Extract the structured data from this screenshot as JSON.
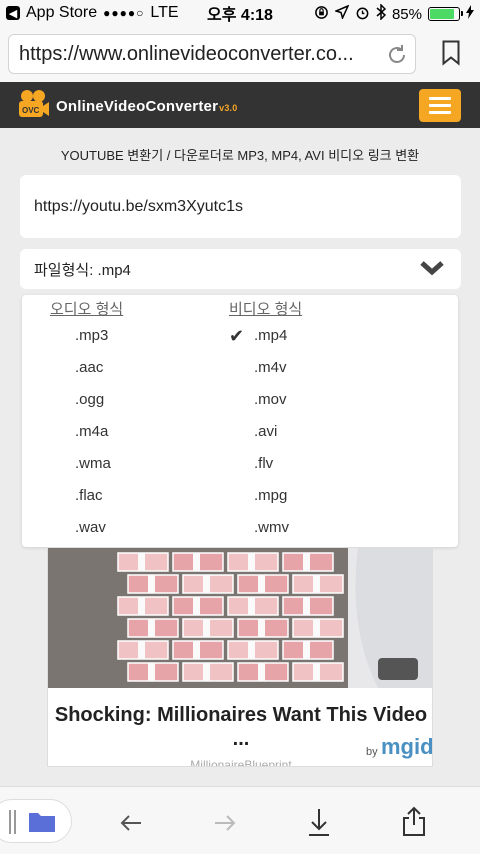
{
  "status_bar": {
    "back_app": "App Store",
    "carrier": "LTE",
    "time": "오후 4:18",
    "battery": "85%"
  },
  "browser": {
    "url": "https://www.onlinevideoconverter.co..."
  },
  "site": {
    "logo_badge": "OVC",
    "logo_name_1": "Online",
    "logo_name_2": "Video",
    "logo_name_3": "Converter",
    "logo_version": "v3.0",
    "tagline": "YOUTUBE 변환기 / 다운로더로 MP3, MP4, AVI 비디오 링크 변환",
    "url_input_value": "https://youtu.be/sxm3Xyutc1s",
    "format_label": "파일형식: .mp4"
  },
  "dropdown": {
    "audio_heading": "오디오 형식",
    "video_heading": "비디오 형식",
    "audio": [
      ".mp3",
      ".aac",
      ".ogg",
      ".m4a",
      ".wma",
      ".flac",
      ".wav"
    ],
    "video": [
      ".mp4",
      ".m4v",
      ".mov",
      ".avi",
      ".flv",
      ".mpg",
      ".wmv"
    ],
    "selected": ".mp4"
  },
  "ad": {
    "title": "Shocking: Millionaires Want This Video ...",
    "by": "by",
    "brand": "mgid",
    "source": "MillionaireBlueprint"
  },
  "colors": {
    "header_bg": "#333333",
    "accent": "#f5a623",
    "battery": "#4cd964"
  }
}
